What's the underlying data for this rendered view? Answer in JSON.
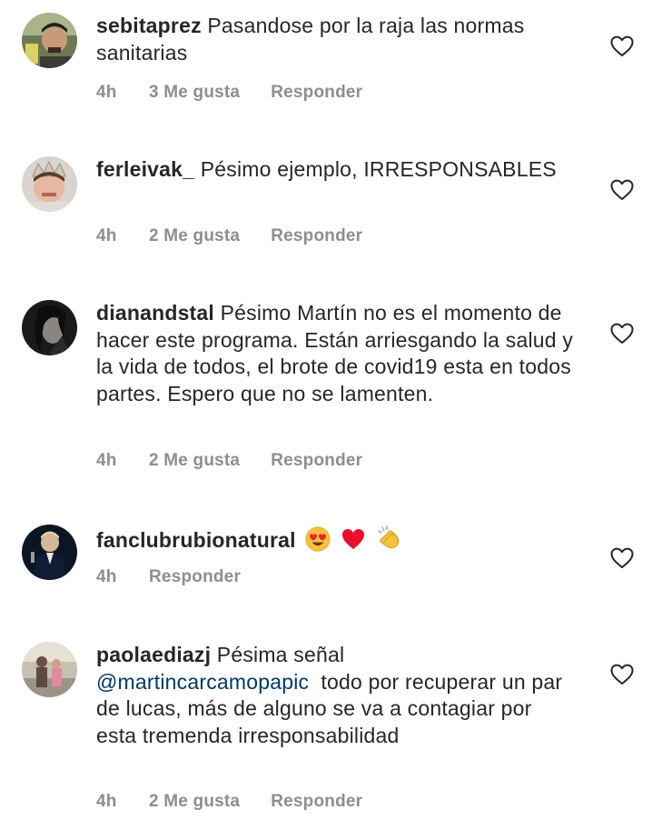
{
  "comments": [
    {
      "username": "sebitaprez",
      "text": "Pasandose por la raja las normas sanitarias",
      "time": "4h",
      "likes": "3 Me gusta",
      "reply": "Responder"
    },
    {
      "username": "ferleivak_",
      "text": "Pésimo ejemplo, IRRESPONSABLES",
      "time": "4h",
      "likes": "2 Me gusta",
      "reply": "Responder"
    },
    {
      "username": "dianandstal",
      "text": "Pésimo Martín no es el momento de hacer este programa. Están arriesgando la salud y la vida de todos, el brote de covid19 esta en todos partes. Espero que no se lamenten.",
      "time": "4h",
      "likes": "2 Me gusta",
      "reply": "Responder"
    },
    {
      "username": "fanclubrubionatural",
      "emojis": [
        "heart-eyes-emoji",
        "red-heart-emoji",
        "clapping-hands-emoji"
      ],
      "time": "4h",
      "reply": "Responder"
    },
    {
      "username": "paolaediazj",
      "text_before": "Pésima señal",
      "mention": "@martincarcamopapic",
      "text_after": "todo por recuperar un par de lucas, más de alguno se va a contagiar por esta tremenda irresponsabilidad",
      "time": "4h",
      "likes": "2 Me gusta",
      "reply": "Responder"
    }
  ],
  "colors": {
    "text": "#262626",
    "meta": "#8e8e8e",
    "mention": "#00376b",
    "background": "#ffffff"
  },
  "icons": {
    "like": "heart-outline-icon"
  }
}
